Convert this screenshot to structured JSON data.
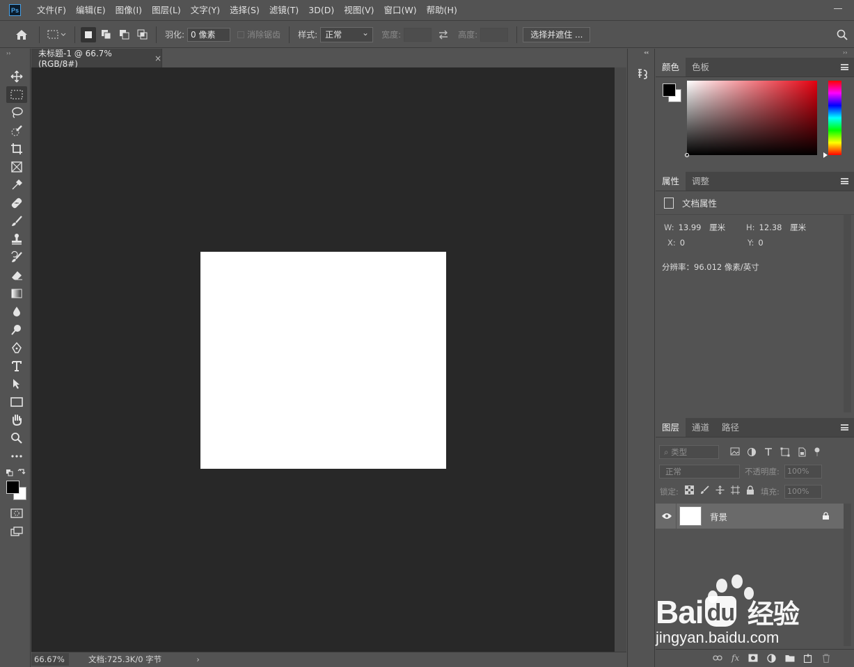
{
  "app": {
    "logo_text": "Ps"
  },
  "menu": [
    "文件(F)",
    "编辑(E)",
    "图像(I)",
    "图层(L)",
    "文字(Y)",
    "选择(S)",
    "滤镜(T)",
    "3D(D)",
    "视图(V)",
    "窗口(W)",
    "帮助(H)"
  ],
  "options_bar": {
    "feather_label": "羽化:",
    "feather_value": "0 像素",
    "antialias_label": "消除锯齿",
    "style_label": "样式:",
    "style_value": "正常",
    "width_label": "宽度:",
    "height_label": "高度:",
    "select_mask_button": "选择并遮住 ..."
  },
  "document": {
    "tab_title": "未标题-1 @ 66.7%(RGB/8#)",
    "close": "×"
  },
  "status_bar": {
    "zoom": "66.67%",
    "doc_info": "文档:725.3K/0 字节",
    "arrow": "›"
  },
  "color_panel": {
    "tabs": [
      "颜色",
      "色板"
    ],
    "foreground": "#000000",
    "background": "#ffffff"
  },
  "properties_panel": {
    "tabs": [
      "属性",
      "调整"
    ],
    "section_title": "文档属性",
    "w_label": "W:",
    "w_value": "13.99",
    "w_unit": "厘米",
    "h_label": "H:",
    "h_value": "12.38",
    "h_unit": "厘米",
    "x_label": "X:",
    "x_value": "0",
    "y_label": "Y:",
    "y_value": "0",
    "resolution": "分辨率：96.012 像素/英寸"
  },
  "layers_panel": {
    "tabs": [
      "图层",
      "通道",
      "路径"
    ],
    "filter_placeholder": "类型",
    "blend_mode": "正常",
    "opacity_label": "不透明度:",
    "opacity_value": "100%",
    "lock_label": "锁定:",
    "fill_label": "填充:",
    "fill_value": "100%",
    "layers": [
      {
        "name": "背景",
        "locked": true,
        "visible": true
      }
    ]
  },
  "watermark": {
    "brand": "Bai",
    "brand_suffix": "du",
    "product": "经验",
    "url": "jingyan.baidu.com"
  }
}
